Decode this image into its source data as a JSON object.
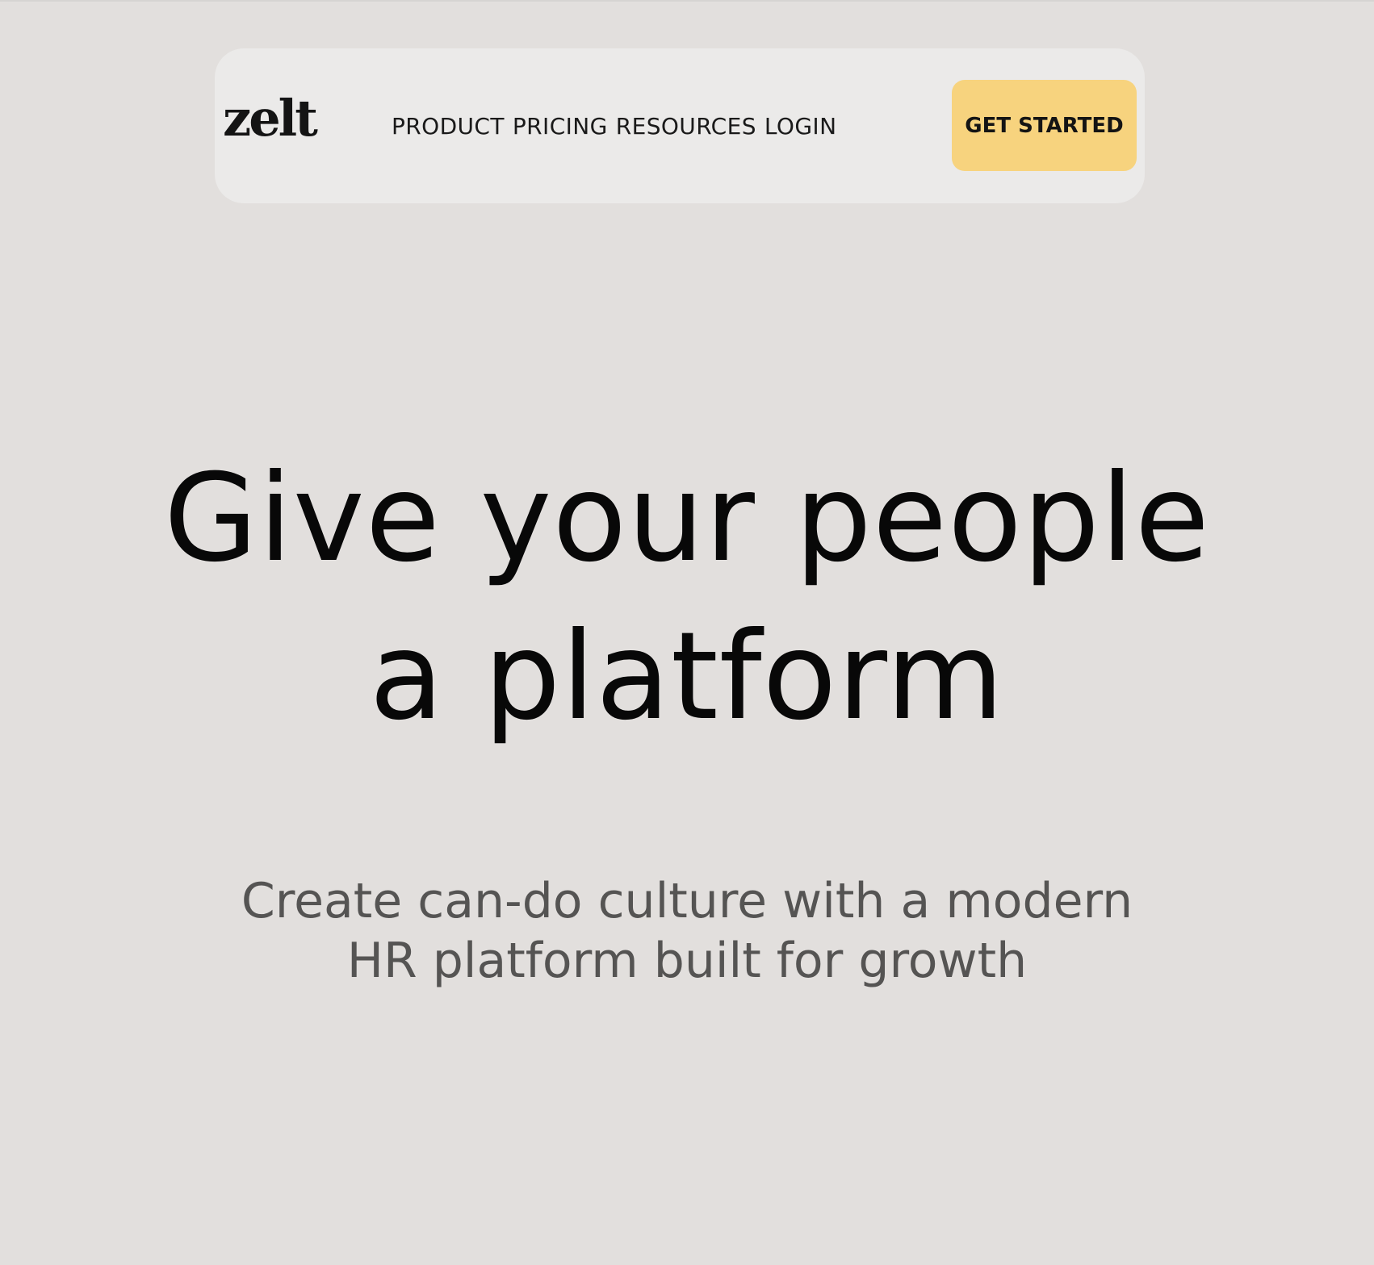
{
  "nav": {
    "logo": "zelt",
    "links": [
      "PRODUCT",
      "PRICING",
      "RESOURCES",
      "LOGIN"
    ],
    "cta_label": "GET STARTED"
  },
  "hero": {
    "title_line1": "Give your people",
    "title_line2": "a platform",
    "subtitle_line1": "Create can-do culture with a modern",
    "subtitle_line2": "HR platform built for growth"
  },
  "colors": {
    "background": "#E2DFDD",
    "navbar": "#EBEAE9",
    "accent": "#F7D37E",
    "text": "#080808",
    "subtext": "#555453"
  }
}
